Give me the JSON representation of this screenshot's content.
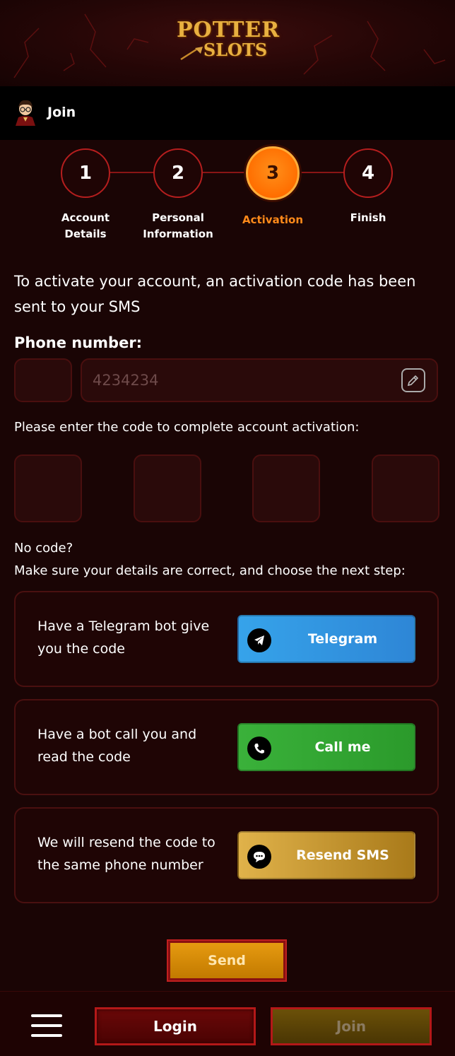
{
  "brand": {
    "line1": "POTTER",
    "line2": "SLOTS"
  },
  "join_bar": {
    "title": "Join"
  },
  "steps": [
    {
      "number": "1",
      "label_1": "Account",
      "label_2": "Details"
    },
    {
      "number": "2",
      "label_1": "Personal",
      "label_2": "Information"
    },
    {
      "number": "3",
      "label_1": "Activation",
      "label_2": ""
    },
    {
      "number": "4",
      "label_1": "Finish",
      "label_2": ""
    }
  ],
  "active_step": 3,
  "activation": {
    "info_text": "To activate your account, an activation code has been sent to your SMS",
    "phone_label": "Phone number:",
    "phone_value": "4234234",
    "code_prompt": "Please enter the code to complete account activation:",
    "no_code_title": "No code?",
    "no_code_text": "Make sure your details are correct, and choose the next step:"
  },
  "options": [
    {
      "text": "Have a Telegram bot give you the code",
      "button": "Telegram",
      "icon": "telegram-icon",
      "color": "#2e90dc"
    },
    {
      "text": "Have a bot call you and read the code",
      "button": "Call me",
      "icon": "phone-icon",
      "color": "#33a833"
    },
    {
      "text": "We will resend the code to the same phone number",
      "button": "Resend SMS",
      "icon": "chat-icon",
      "color": "#c8962c"
    }
  ],
  "send_label": "Send",
  "bottom_bar": {
    "login_label": "Login",
    "join_label": "Join"
  },
  "colors": {
    "accent": "#ff7a00",
    "background": "#1a0505",
    "border": "#b51e1e"
  }
}
